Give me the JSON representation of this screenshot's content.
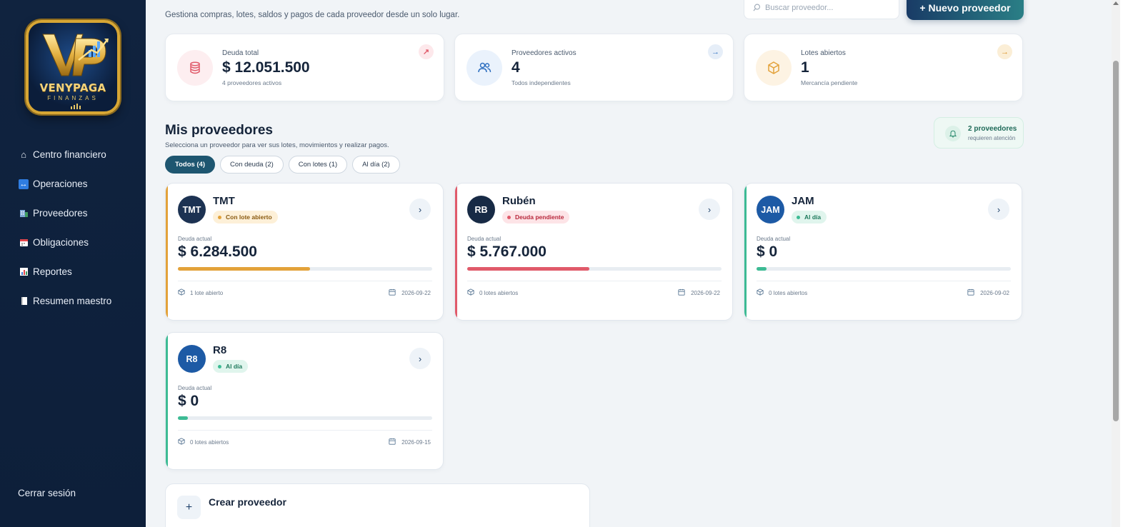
{
  "brand": {
    "name": "VENYPAGA",
    "sub": "FINANZAS",
    "gold": "#d7a634"
  },
  "sidebar": {
    "items": [
      {
        "label": "Centro financiero",
        "icon": "home-icon",
        "glyph": "⌂"
      },
      {
        "label": "Operaciones",
        "icon": "arrows-icon",
        "glyph": "↔"
      },
      {
        "label": "Proveedores",
        "icon": "building-icon",
        "glyph": "▦"
      },
      {
        "label": "Obligaciones",
        "icon": "calendar-icon",
        "glyph": "▤"
      },
      {
        "label": "Reportes",
        "icon": "bar-chart-icon",
        "glyph": "▥"
      },
      {
        "label": "Resumen maestro",
        "icon": "document-icon",
        "glyph": "▯"
      }
    ],
    "logout": "Cerrar sesión"
  },
  "header": {
    "subtitle": "Gestiona compras, lotes, saldos y pagos de cada proveedor desde un solo lugar.",
    "search_placeholder": "Buscar proveedor...",
    "new_button": "+  Nuevo proveedor"
  },
  "stats": [
    {
      "label": "Deuda total",
      "value": "$ 12.051.500",
      "sub": "4 proveedores activos",
      "corner": "↗",
      "accent": "#e05a6a"
    },
    {
      "label": "Proveedores activos",
      "value": "4",
      "sub": "Todos independientes",
      "corner": "→",
      "accent": "#2e6fc0"
    },
    {
      "label": "Lotes abiertos",
      "value": "1",
      "sub": "Mercancía pendiente",
      "corner": "→",
      "accent": "#e3a23a"
    }
  ],
  "section": {
    "title": "Mis proveedores",
    "subtitle": "Selecciona un proveedor para ver sus lotes, movimientos y realizar pagos.",
    "alert_count": "2 proveedores",
    "alert_text": "requieren atención"
  },
  "filters": [
    {
      "label": "Todos (4)",
      "active": true
    },
    {
      "label": "Con deuda (2)",
      "active": false
    },
    {
      "label": "Con lotes (1)",
      "active": false
    },
    {
      "label": "Al día (2)",
      "active": false
    }
  ],
  "providers": [
    {
      "initials": "TMT",
      "name": "TMT",
      "status": "Con lote abierto",
      "debt_label": "Deuda actual",
      "debt": "$ 6.284.500",
      "progress": 0.52,
      "lots": "1 lote abierto",
      "date": "2026-09-22",
      "accent": "#e3a23a",
      "avatar_color": "#1c3252",
      "badge_bg": "#fdf0d8",
      "badge_fg": "#8a5a10"
    },
    {
      "initials": "RB",
      "name": "Rubén",
      "status": "Deuda pendiente",
      "debt_label": "Deuda actual",
      "debt": "$ 5.767.000",
      "progress": 0.48,
      "lots": "0 lotes abiertos",
      "date": "2026-09-22",
      "accent": "#e05a6a",
      "avatar_color": "#172a45",
      "badge_bg": "#fde4e7",
      "badge_fg": "#b8283c"
    },
    {
      "initials": "JAM",
      "name": "JAM",
      "status": "Al día",
      "debt_label": "Deuda actual",
      "debt": "$ 0",
      "progress": 0.04,
      "lots": "0 lotes abiertos",
      "date": "2026-09-02",
      "accent": "#3dbb94",
      "avatar_color": "#1d5aa5",
      "badge_bg": "#e0f5ed",
      "badge_fg": "#1e7a5c"
    },
    {
      "initials": "R8",
      "name": "R8",
      "status": "Al día",
      "debt_label": "Deuda actual",
      "debt": "$ 0",
      "progress": 0.04,
      "lots": "0 lotes abiertos",
      "date": "2026-09-15",
      "accent": "#3dbb94",
      "avatar_color": "#1d5aa5",
      "badge_bg": "#e0f5ed",
      "badge_fg": "#1e7a5c"
    }
  ],
  "create": {
    "title": "Crear proveedor",
    "plus": "+"
  }
}
